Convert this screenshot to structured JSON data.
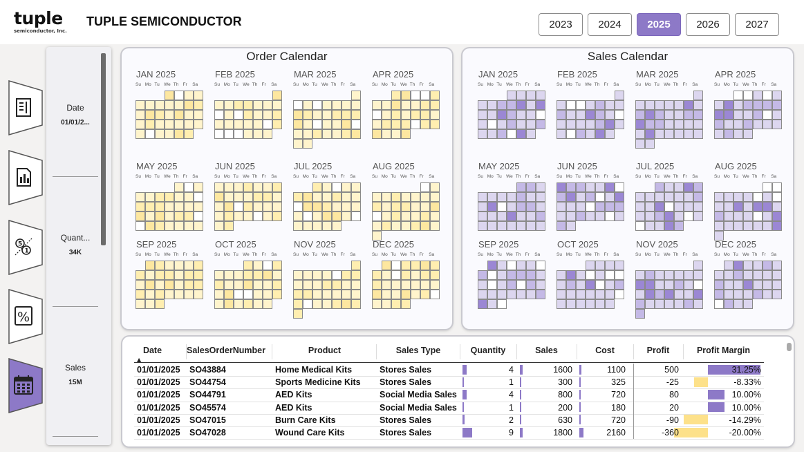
{
  "header": {
    "logo_word": "tuple",
    "logo_sub": "semiconductor, Inc.",
    "title": "TUPLE SEMICONDUCTOR"
  },
  "years": [
    {
      "label": "2023",
      "active": false
    },
    {
      "label": "2024",
      "active": false
    },
    {
      "label": "2025",
      "active": true
    },
    {
      "label": "2026",
      "active": false
    },
    {
      "label": "2027",
      "active": false
    }
  ],
  "nav": [
    {
      "icon": "report-list-icon",
      "active": false
    },
    {
      "icon": "report-chart-icon",
      "active": false
    },
    {
      "icon": "ratio-icon",
      "active": false
    },
    {
      "icon": "percent-icon",
      "active": false
    },
    {
      "icon": "calendar-icon",
      "active": true
    }
  ],
  "kpis": [
    {
      "label": "Date",
      "value": "01/01/2..."
    },
    {
      "label": "Quant...",
      "value": "34K"
    },
    {
      "label": "Sales",
      "value": "15M"
    }
  ],
  "calendars": {
    "order": {
      "title": "Order Calendar",
      "months": [
        "JAN 2025",
        "FEB 2025",
        "MAR 2025",
        "APR 2025",
        "MAY 2025",
        "JUN 2025",
        "JUL 2025",
        "AUG 2025",
        "SEP 2025",
        "OCT 2025",
        "NOV 2025",
        "DEC 2025"
      ],
      "colors": [
        "#ffffff",
        "#fff4cc",
        "#ffeeb0",
        "#fde7a0"
      ]
    },
    "sales": {
      "title": "Sales Calendar",
      "months": [
        "JAN 2025",
        "FEB 2025",
        "MAR 2025",
        "APR 2025",
        "MAY 2025",
        "JUN 2025",
        "JUL 2025",
        "AUG 2025",
        "SEP 2025",
        "OCT 2025",
        "NOV 2025",
        "DEC 2025"
      ],
      "colors": [
        "#ffffff",
        "#dcd6ef",
        "#c4b9e6",
        "#9b87d4"
      ]
    },
    "dow": [
      "Su",
      "Mo",
      "Tu",
      "We",
      "Th",
      "Fr",
      "Sa"
    ]
  },
  "table": {
    "columns": [
      "Date",
      "SalesOrderNumber",
      "Product",
      "Sales Type",
      "Quantity",
      "Sales",
      "Cost",
      "Profit",
      "Profit Margin"
    ],
    "rows": [
      {
        "date": "01/01/2025",
        "order": "SO43884",
        "product": "Home Medical Kits",
        "type": "Stores Sales",
        "quantity": "4",
        "sales": "1600",
        "cost": "1100",
        "profit": "500",
        "margin": "31.25%",
        "margin_value": 31.25
      },
      {
        "date": "01/01/2025",
        "order": "SO44754",
        "product": "Sports Medicine Kits",
        "type": "Stores Sales",
        "quantity": "1",
        "sales": "300",
        "cost": "325",
        "profit": "-25",
        "margin": "-8.33%",
        "margin_value": -8.33
      },
      {
        "date": "01/01/2025",
        "order": "SO44791",
        "product": "AED Kits",
        "type": "Social Media Sales",
        "quantity": "4",
        "sales": "800",
        "cost": "720",
        "profit": "80",
        "margin": "10.00%",
        "margin_value": 10.0
      },
      {
        "date": "01/01/2025",
        "order": "SO45574",
        "product": "AED Kits",
        "type": "Social Media Sales",
        "quantity": "1",
        "sales": "200",
        "cost": "180",
        "profit": "20",
        "margin": "10.00%",
        "margin_value": 10.0
      },
      {
        "date": "01/01/2025",
        "order": "SO47015",
        "product": "Burn Care Kits",
        "type": "Stores Sales",
        "quantity": "2",
        "sales": "630",
        "cost": "720",
        "profit": "-90",
        "margin": "-14.29%",
        "margin_value": -14.29
      },
      {
        "date": "01/01/2025",
        "order": "SO47028",
        "product": "Wound Care Kits",
        "type": "Stores Sales",
        "quantity": "9",
        "sales": "1800",
        "cost": "2160",
        "profit": "-360",
        "margin": "-20.00%",
        "margin_value": -20.0
      }
    ]
  },
  "colors": {
    "accent": "#8d79c7",
    "positive_bar": "#8d79c7",
    "negative_bar": "#fde18a"
  }
}
